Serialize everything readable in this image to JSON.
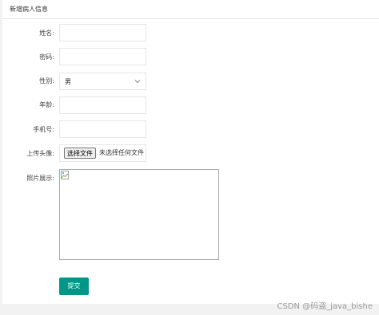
{
  "panel": {
    "title": "新增病人信息"
  },
  "form": {
    "name_label": "姓名:",
    "name_value": "",
    "password_label": "密码:",
    "password_value": "",
    "gender_label": "性别:",
    "gender_selected": "男",
    "age_label": "年龄:",
    "age_value": "",
    "phone_label": "手机号:",
    "phone_value": "",
    "avatar_label": "上传头像:",
    "choose_file_label": "选择文件",
    "no_file_text": "未选择任何文件",
    "photo_label": "照片展示:",
    "submit_label": "提交"
  },
  "watermark": "CSDN @码盗_java_bishe",
  "colors": {
    "accent": "#009688",
    "border": "#e6e6e6",
    "background": "#f2f2f2"
  },
  "icons": {
    "select_arrow": "chevron-down-icon",
    "image_placeholder": "broken-image-icon"
  }
}
